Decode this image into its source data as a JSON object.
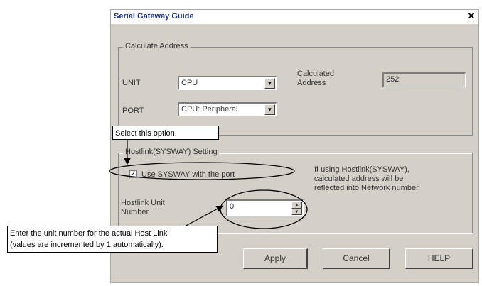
{
  "dialog": {
    "title": "Serial Gateway Guide",
    "close_glyph": "✕"
  },
  "calc_group": {
    "legend": "Calculate Address",
    "unit_label": "UNIT",
    "unit_value": "CPU",
    "port_label": "PORT",
    "port_value": "CPU: Peripheral",
    "calc_label_line1": "Calculated",
    "calc_label_line2": "Address",
    "calc_value": "252"
  },
  "hostlink_group": {
    "legend": "Hostlink(SYSWAY) Setting",
    "checkbox_label": "Use SYSWAY with the port",
    "checkbox_checked": true,
    "note_line1": "If using Hostlink(SYSWAY),",
    "note_line2": "calculated address will be",
    "note_line3": "reflected into Network number",
    "unit_number_label_line1": "Hostlink Unit",
    "unit_number_label_line2": "Number",
    "unit_number_value": "0"
  },
  "buttons": {
    "apply": "Apply",
    "cancel": "Cancel",
    "help": "HELP"
  },
  "callouts": {
    "select_option": "Select this option.",
    "unit_number_line1": "Enter the unit number for the actual Host Link",
    "unit_number_line2": "(values are incremented by 1 automatically)."
  },
  "icons": {
    "dropdown": "▼",
    "spin_up": "▲",
    "spin_down": "▼",
    "check": "✓"
  }
}
